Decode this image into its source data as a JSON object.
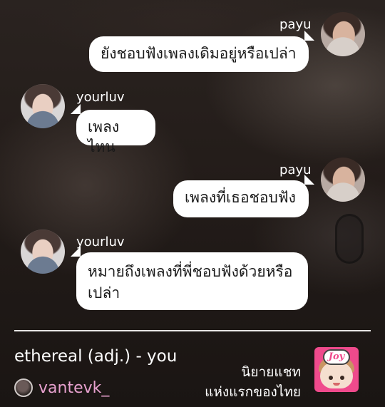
{
  "chat": {
    "messages": [
      {
        "sender": "payu",
        "side": "right",
        "text": "ยังชอบฟังเพลงเดิมอยู่หรือเปล่า"
      },
      {
        "sender": "yourluv",
        "side": "left",
        "text": "เพลงไหน"
      },
      {
        "sender": "payu",
        "side": "right",
        "text": "เพลงที่เธอชอบฟัง"
      },
      {
        "sender": "yourluv",
        "side": "left",
        "text": "หมายถึงเพลงที่พี่ชอบฟังด้วยหรือเปล่า"
      }
    ]
  },
  "footer": {
    "title": "ethereal (adj.) - you",
    "handle": "vantevk_",
    "promo_line1": "นิยายแชท",
    "promo_line2": "แห่งแรกของไทย",
    "logo_text": "Joy"
  },
  "colors": {
    "handle": "#e7a1cf",
    "bubble": "#ffffff",
    "logo_bg": "#ef4a8c"
  }
}
